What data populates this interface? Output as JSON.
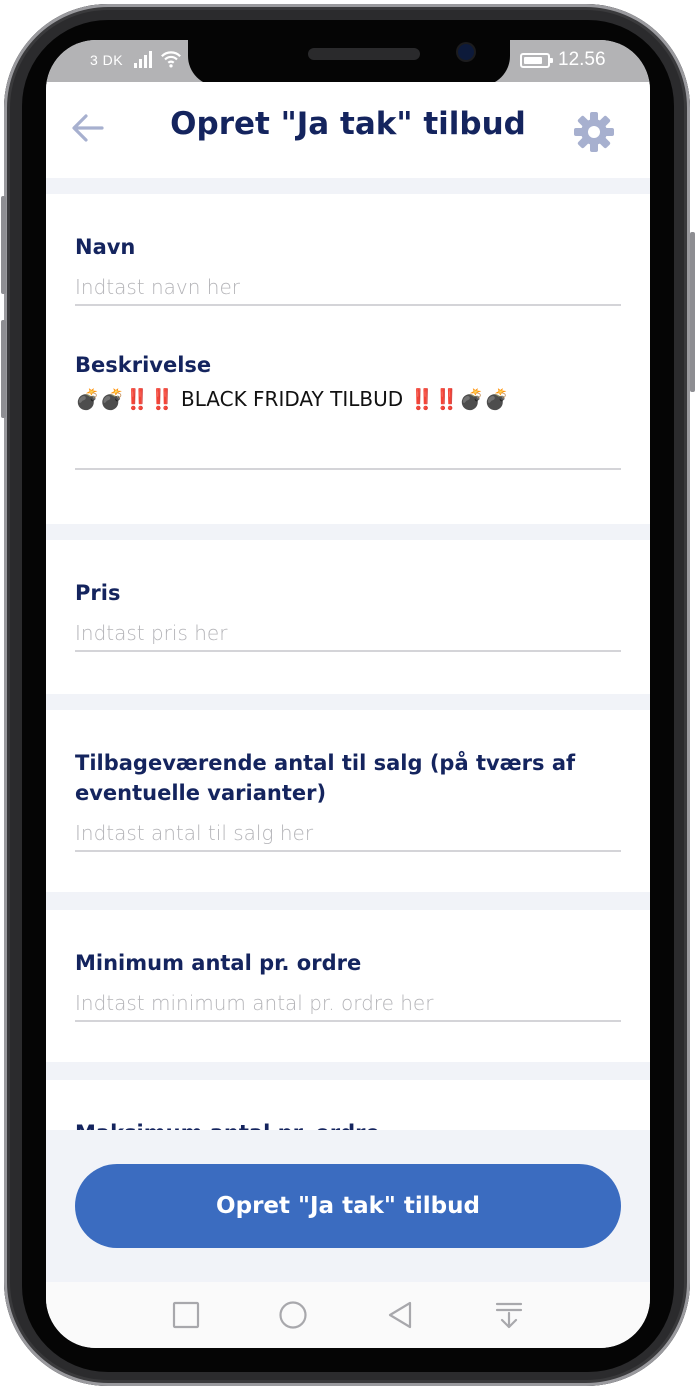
{
  "status_bar": {
    "carrier": "3 DK",
    "time": "12.56"
  },
  "header": {
    "title": "Opret \"Ja tak\" tilbud"
  },
  "form": {
    "name": {
      "label": "Navn",
      "placeholder": "Indtast navn her",
      "value": ""
    },
    "description": {
      "label": "Beskrivelse",
      "value": "💣💣‼️‼️ BLACK FRIDAY TILBUD ‼️‼️💣💣"
    },
    "price": {
      "label": "Pris",
      "placeholder": "Indtast pris her",
      "value": ""
    },
    "remaining": {
      "label": "Tilbageværende antal til salg (på tværs af eventuelle varianter)",
      "placeholder": "Indtast antal til salg her",
      "value": ""
    },
    "minimum": {
      "label": "Minimum antal pr. ordre",
      "placeholder": "Indtast minimum antal pr. ordre her",
      "value": ""
    },
    "maximum": {
      "label": "Maksimum antal pr. ordre"
    }
  },
  "submit_label": "Opret \"Ja tak\" tilbud",
  "colors": {
    "title": "#14245e",
    "primary": "#3b6cc0",
    "icon": "#a7b0cf",
    "background": "#f1f3f8"
  },
  "icons": {
    "back": "arrow-left-icon",
    "settings": "gear-icon",
    "nav": [
      "square-icon",
      "circle-icon",
      "triangle-back-icon",
      "notification-pull-icon"
    ]
  }
}
